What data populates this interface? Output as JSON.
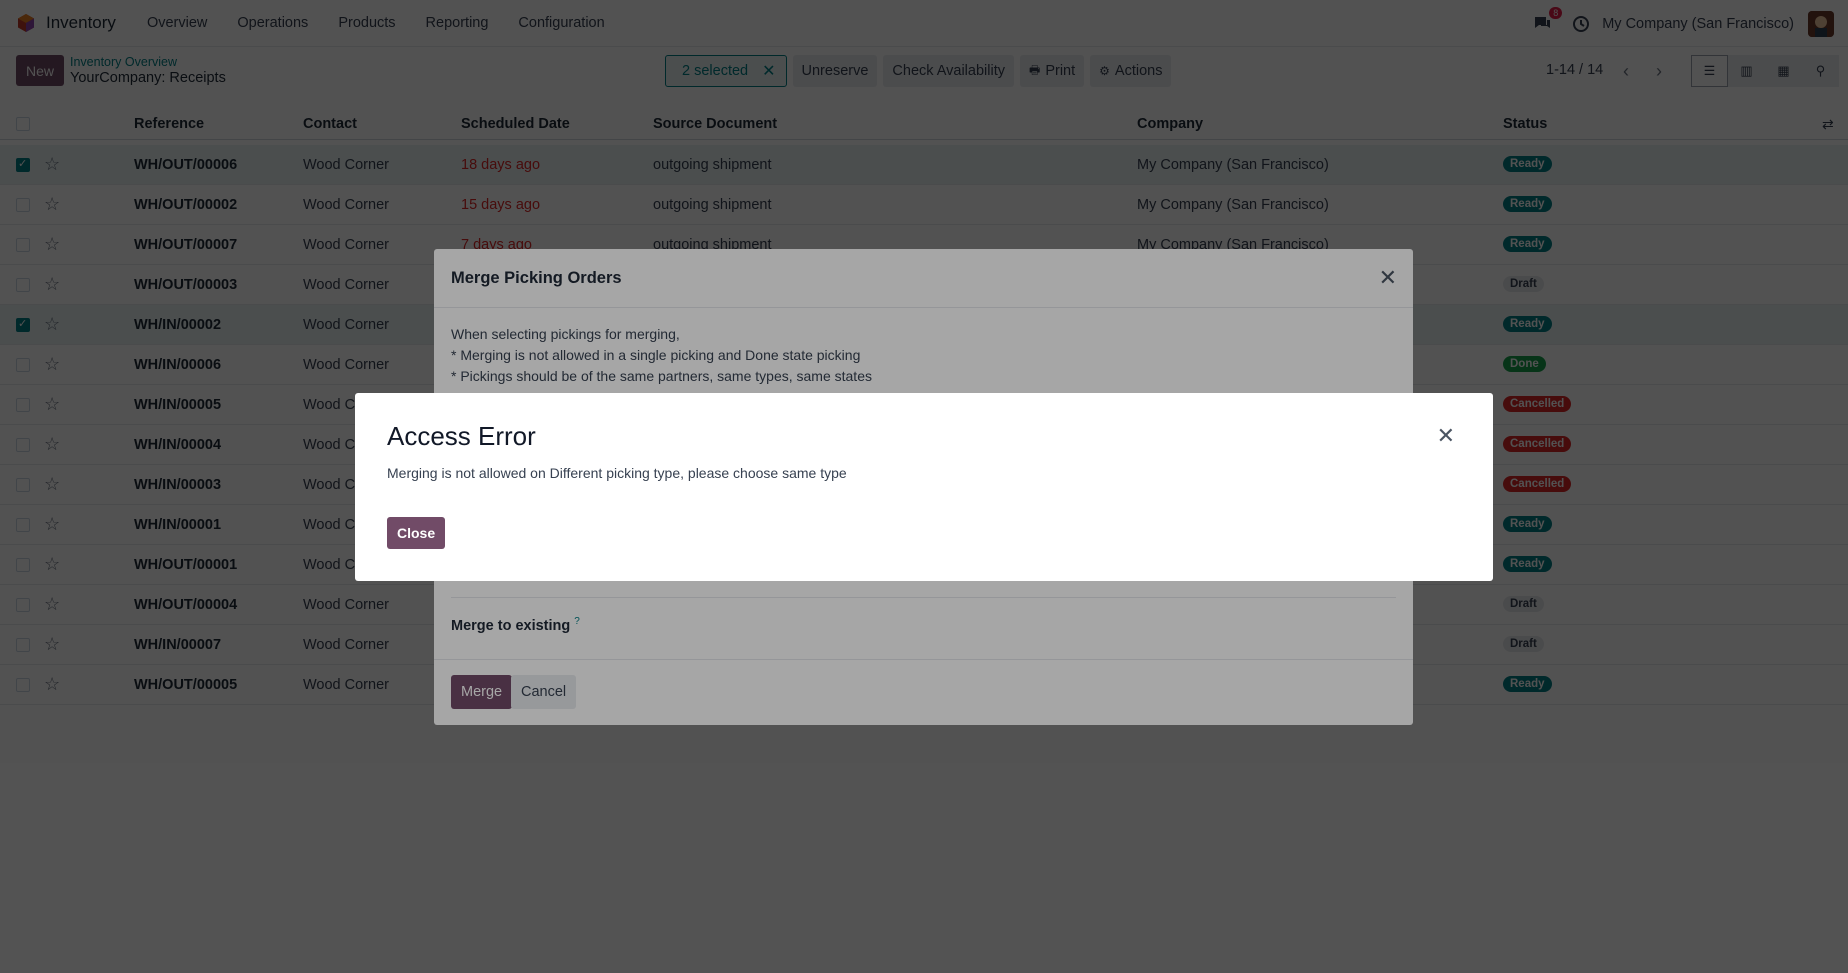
{
  "navbar": {
    "app_name": "Inventory",
    "menu": [
      "Overview",
      "Operations",
      "Products",
      "Reporting",
      "Configuration"
    ],
    "chat_count": "8",
    "company": "My Company (San Francisco)"
  },
  "control": {
    "new_label": "New",
    "breadcrumb_parent": "Inventory Overview",
    "breadcrumb_current": "YourCompany: Receipts",
    "selected_label": "2 selected",
    "unreserve": "Unreserve",
    "check_availability": "Check Availability",
    "print": "Print",
    "actions": "Actions",
    "pager": "1-14 / 14"
  },
  "table": {
    "headers": {
      "reference": "Reference",
      "contact": "Contact",
      "scheduled_date": "Scheduled Date",
      "source_document": "Source Document",
      "company": "Company",
      "status": "Status"
    },
    "rows": [
      {
        "ref": "WH/OUT/00006",
        "contact": "Wood Corner",
        "date": "18 days ago",
        "source": "outgoing shipment",
        "company": "My Company (San Francisco)",
        "status": "Ready",
        "checked": true
      },
      {
        "ref": "WH/OUT/00002",
        "contact": "Wood Corner",
        "date": "15 days ago",
        "source": "outgoing shipment",
        "company": "My Company (San Francisco)",
        "status": "Ready",
        "checked": false
      },
      {
        "ref": "WH/OUT/00007",
        "contact": "Wood Corner",
        "date": "7 days ago",
        "source": "outgoing shipment",
        "company": "My Company (San Francisco)",
        "status": "Ready",
        "checked": false
      },
      {
        "ref": "WH/OUT/00003",
        "contact": "Wood Corner",
        "date": "",
        "source": "",
        "company": "",
        "status": "Draft",
        "checked": false
      },
      {
        "ref": "WH/IN/00002",
        "contact": "Wood Corner",
        "date": "",
        "source": "",
        "company": "",
        "status": "Ready",
        "checked": true
      },
      {
        "ref": "WH/IN/00006",
        "contact": "Wood Corner",
        "date": "",
        "source": "",
        "company": "",
        "status": "Done",
        "checked": false
      },
      {
        "ref": "WH/IN/00005",
        "contact": "Wood Co",
        "date": "",
        "source": "",
        "company": "",
        "status": "Cancelled",
        "checked": false
      },
      {
        "ref": "WH/IN/00004",
        "contact": "Wood Co",
        "date": "",
        "source": "",
        "company": "",
        "status": "Cancelled",
        "checked": false
      },
      {
        "ref": "WH/IN/00003",
        "contact": "Wood Co",
        "date": "",
        "source": "",
        "company": "",
        "status": "Cancelled",
        "checked": false
      },
      {
        "ref": "WH/IN/00001",
        "contact": "Wood Co",
        "date": "",
        "source": "",
        "company": "",
        "status": "Ready",
        "checked": false
      },
      {
        "ref": "WH/OUT/00001",
        "contact": "Wood Co",
        "date": "",
        "source": "",
        "company": "",
        "status": "Ready",
        "checked": false
      },
      {
        "ref": "WH/OUT/00004",
        "contact": "Wood Corner",
        "date": "",
        "source": "",
        "company": "",
        "status": "Draft",
        "checked": false
      },
      {
        "ref": "WH/IN/00007",
        "contact": "Wood Corner",
        "date": "",
        "source": "",
        "company": "",
        "status": "Draft",
        "checked": false
      },
      {
        "ref": "WH/OUT/00005",
        "contact": "Wood Corner",
        "date": "",
        "source": "",
        "company": "",
        "status": "Ready",
        "checked": false
      }
    ]
  },
  "status_colors": {
    "Ready": "#017e84",
    "Draft": "#e5e7eb",
    "Done": "#16a34a",
    "Cancelled": "#dc2626"
  },
  "merge_dialog": {
    "title": "Merge Picking Orders",
    "line1": "When selecting pickings for merging,",
    "line2": "* Merging is not allowed in a single picking and Done state picking",
    "line3": "* Pickings should be of the same partners, same types, same states",
    "merge_to_existing": "Merge to existing",
    "help_mark": "?",
    "merge": "Merge",
    "cancel": "Cancel"
  },
  "error_dialog": {
    "title": "Access Error",
    "message": "Merging is not allowed on Different picking type, please choose same type",
    "close": "Close"
  }
}
